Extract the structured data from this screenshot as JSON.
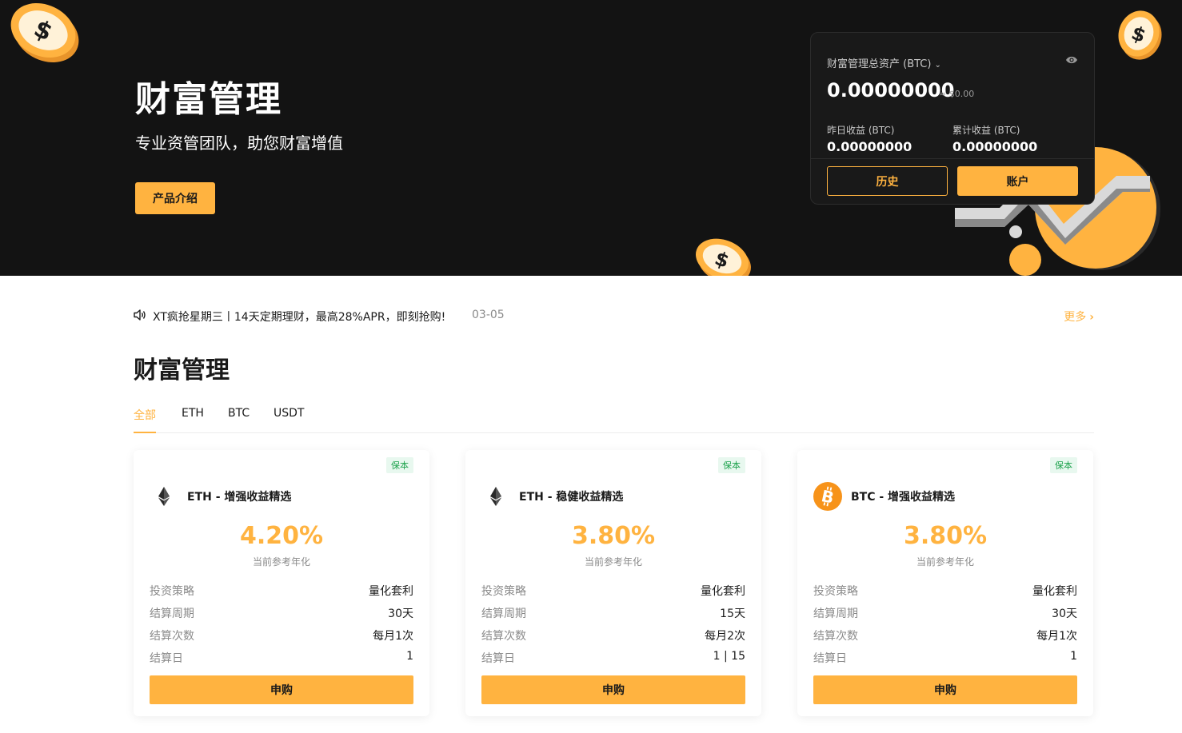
{
  "hero": {
    "title": "财富管理",
    "subtitle": "专业资管团队，助您财富增值",
    "intro_button": "产品介绍"
  },
  "asset_card": {
    "total_label": "财富管理总资产 (BTC)",
    "total_value": "0.00000000",
    "total_usd": "≈ $0.00",
    "yesterday_label": "昨日收益 (BTC)",
    "yesterday_value": "0.00000000",
    "cumulative_label": "累计收益 (BTC)",
    "cumulative_value": "0.00000000",
    "history_button": "历史",
    "account_button": "账户"
  },
  "notice": {
    "text": "XT疯抢星期三丨14天定期理财，最高28%APR，即刻抢购!",
    "date": "03-05",
    "more": "更多"
  },
  "section": {
    "title": "财富管理",
    "tabs": [
      "全部",
      "ETH",
      "BTC",
      "USDT"
    ],
    "active_tab": "全部"
  },
  "products": [
    {
      "badge": "保本",
      "coin_icon": "eth-icon",
      "name": "ETH - 增强收益精选",
      "rate": "4.20%",
      "rate_label": "当前参考年化",
      "rows": [
        {
          "k": "投资策略",
          "v": "量化套利"
        },
        {
          "k": "结算周期",
          "v": "30天"
        },
        {
          "k": "结算次数",
          "v": "每月1次"
        },
        {
          "k": "结算日",
          "v": "1"
        }
      ],
      "button": "申购"
    },
    {
      "badge": "保本",
      "coin_icon": "eth-icon",
      "name": "ETH - 稳健收益精选",
      "rate": "3.80%",
      "rate_label": "当前参考年化",
      "rows": [
        {
          "k": "投资策略",
          "v": "量化套利"
        },
        {
          "k": "结算周期",
          "v": "15天"
        },
        {
          "k": "结算次数",
          "v": "每月2次"
        },
        {
          "k": "结算日",
          "v": "1 | 15"
        }
      ],
      "button": "申购"
    },
    {
      "badge": "保本",
      "coin_icon": "btc-icon",
      "name": "BTC - 增强收益精选",
      "rate": "3.80%",
      "rate_label": "当前参考年化",
      "rows": [
        {
          "k": "投资策略",
          "v": "量化套利"
        },
        {
          "k": "结算周期",
          "v": "30天"
        },
        {
          "k": "结算次数",
          "v": "每月1次"
        },
        {
          "k": "结算日",
          "v": "1"
        }
      ],
      "button": "申购"
    }
  ],
  "colors": {
    "accent": "#ffb340",
    "hero_bg": "#131313",
    "badge_green": "#1fa34e"
  }
}
